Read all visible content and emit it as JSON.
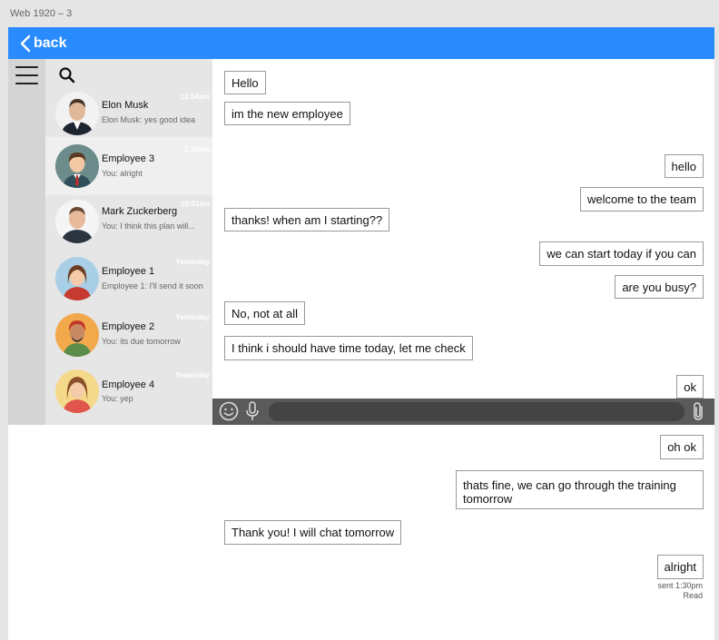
{
  "frame_label": "Web 1920 – 3",
  "topbar": {
    "back_label": "back",
    "accent": "#2a8bff"
  },
  "contacts": [
    {
      "name": "Elon Musk",
      "preview": "Elon Musk: yes good idea",
      "time": "12:04pm",
      "avatar": "elon-musk-avatar"
    },
    {
      "name": "Employee 3",
      "preview": "You: alright",
      "time": "1:30pm",
      "avatar": "employee-3-avatar",
      "active": true
    },
    {
      "name": "Mark Zuckerberg",
      "preview": "You: I think this plan will...",
      "time": "10:31am",
      "avatar": "mark-zuckerberg-avatar"
    },
    {
      "name": "Employee 1",
      "preview": "Employee 1: I'll send it soon",
      "time": "Yesterday",
      "avatar": "employee-1-avatar"
    },
    {
      "name": "Employee 2",
      "preview": "You: its due tomorrow",
      "time": "Yesterday",
      "avatar": "employee-2-avatar"
    },
    {
      "name": "Employee 4",
      "preview": "You: yep",
      "time": "Yesterday",
      "avatar": "employee-4-avatar"
    }
  ],
  "messages": [
    {
      "text": "Hello",
      "side": "left"
    },
    {
      "text": "im the new employee",
      "side": "left"
    },
    {
      "text": "hello",
      "side": "right"
    },
    {
      "text": "welcome to the team",
      "side": "right"
    },
    {
      "text": "thanks! when am I starting??",
      "side": "left"
    },
    {
      "text": "we can start today if you can",
      "side": "right"
    },
    {
      "text": "are you busy?",
      "side": "right"
    },
    {
      "text": "No, not at all",
      "side": "left"
    },
    {
      "text": "I think i should have time today, let me check",
      "side": "left"
    },
    {
      "text": "ok",
      "side": "right"
    },
    {
      "text": "oh ok",
      "side": "right"
    },
    {
      "text": "thats fine, we can go through the training tomorrow",
      "side": "right"
    },
    {
      "text": "Thank you! I will chat tomorrow",
      "side": "left"
    },
    {
      "text": "alright",
      "side": "right"
    }
  ],
  "last_message_meta": {
    "sent": "sent 1:30pm",
    "status": "Read"
  },
  "composer": {
    "placeholder": ""
  }
}
